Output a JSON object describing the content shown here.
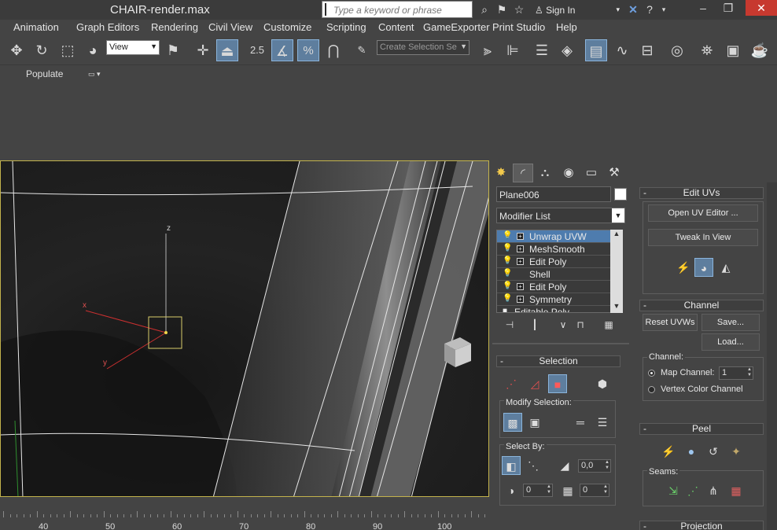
{
  "titlebar": {
    "title": "CHAIR-render.max",
    "search_placeholder": "Type a keyword or phrase",
    "signin": "Sign In"
  },
  "menu": {
    "items": [
      "Animation",
      "Graph Editors",
      "Rendering",
      "Civil View",
      "Customize",
      "Scripting",
      "Content",
      "GameExporter",
      "Print Studio",
      "Help"
    ]
  },
  "toolbar": {
    "ref_coord": "View",
    "snap_label": "2.5",
    "selection_set_placeholder": "Create Selection Se"
  },
  "ribbon": {
    "populate": "Populate"
  },
  "viewport": {
    "axes": {
      "x": "x",
      "y": "y",
      "z": "z"
    }
  },
  "ruler": {
    "labels": [
      "40",
      "50",
      "60",
      "70",
      "80",
      "90",
      "100"
    ]
  },
  "cmdpanel": {
    "object_name": "Plane006",
    "modifier_list": "Modifier List",
    "stack": [
      {
        "label": "Unwrap UVW",
        "expandable": true,
        "selected": true
      },
      {
        "label": "MeshSmooth",
        "expandable": true,
        "selected": false
      },
      {
        "label": "Edit Poly",
        "expandable": true,
        "selected": false
      },
      {
        "label": "Shell",
        "expandable": false,
        "selected": false
      },
      {
        "label": "Edit Poly",
        "expandable": true,
        "selected": false
      },
      {
        "label": "Symmetry",
        "expandable": true,
        "selected": false
      },
      {
        "label": "Editable Poly",
        "expandable": false,
        "selected": false
      }
    ],
    "selection": {
      "header": "Selection",
      "modify_selection": "Modify Selection:",
      "select_by": "Select By:",
      "angle_value": "0,0",
      "spin1_value": "0",
      "spin2_value": "0"
    }
  },
  "rightpanel": {
    "edit_uvs": {
      "header": "Edit UVs",
      "open_uv_editor": "Open UV Editor ...",
      "tweak_in_view": "Tweak In View"
    },
    "channel": {
      "header": "Channel",
      "reset_uvws": "Reset UVWs",
      "save": "Save...",
      "load": "Load...",
      "channel_label": "Channel:",
      "map_channel": "Map Channel:",
      "map_channel_value": "1",
      "vertex_color_channel": "Vertex Color Channel"
    },
    "peel": {
      "header": "Peel",
      "seams": "Seams:"
    },
    "projection": {
      "header": "Projection"
    }
  }
}
